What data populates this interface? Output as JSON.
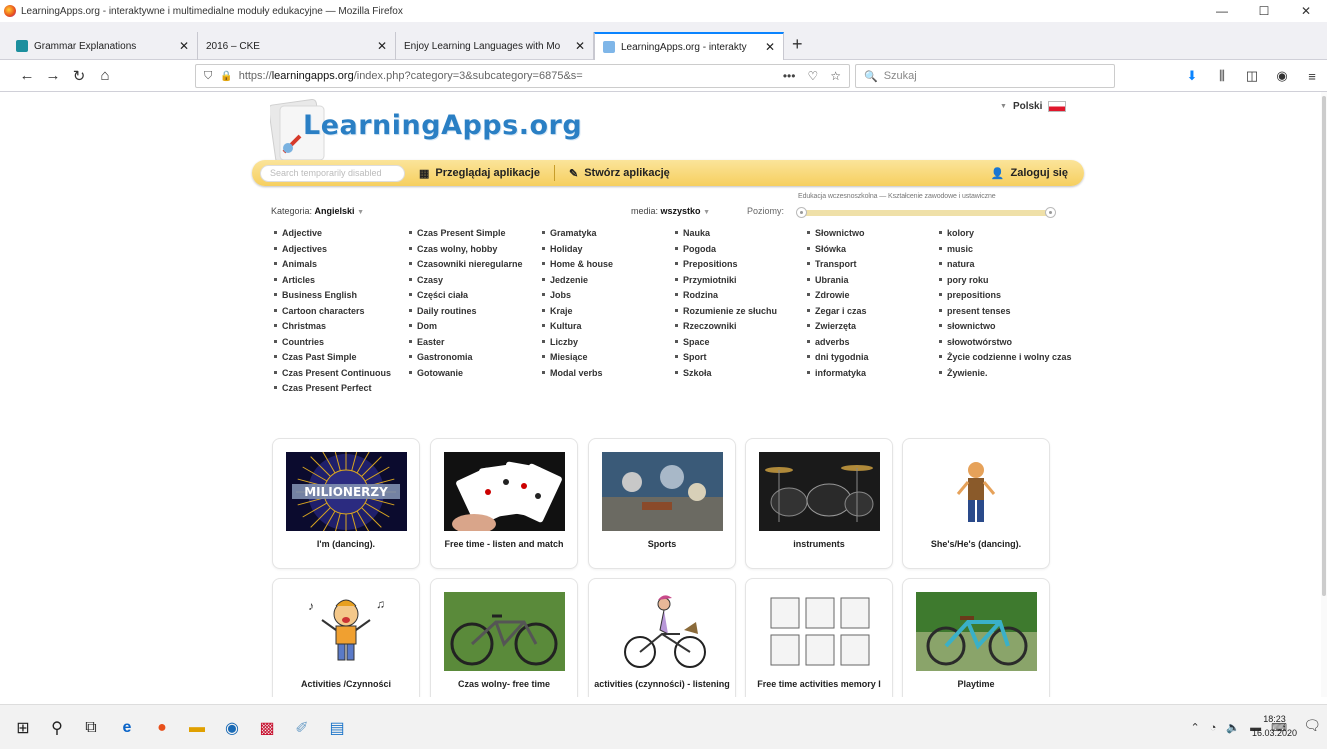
{
  "window": {
    "title": "LearningApps.org - interaktywne i multimedialne moduły edukacyjne — Mozilla Firefox",
    "controls": {
      "minimize": "—",
      "maximize": "☐",
      "close": "✕"
    }
  },
  "tabs": [
    {
      "label": "Grammar Explanations",
      "active": false
    },
    {
      "label": "2016 – CKE",
      "active": false
    },
    {
      "label": "Enjoy Learning Languages with Mo",
      "active": false
    },
    {
      "label": "LearningApps.org - interakty",
      "active": true
    }
  ],
  "newtab_label": "+",
  "nav": {
    "url_prefix": "https://",
    "url_domain": "learningapps.org",
    "url_path": "/index.php?category=3&subcategory=6875&s=",
    "more_icon": "•••",
    "search_placeholder": "Szukaj"
  },
  "site": {
    "logo": "LearningApps.org",
    "language": "Polski",
    "search_placeholder": "Search temporarily disabled",
    "browse_label": "Przeglądaj aplikacje",
    "create_label": "Stwórz aplikację",
    "login_label": "Zaloguj się",
    "levels_caption": "Edukacja wczesnoszkolna — Kształcenie zawodowe i ustawiczne",
    "category_label": "Kategoria:",
    "category_value": "Angielski",
    "media_label": "media:",
    "media_value": "wszystko",
    "levels_label": "Poziomy:",
    "accent": "#f6cf5f"
  },
  "categories": [
    [
      "Adjective",
      "Adjectives",
      "Animals",
      "Articles",
      "Business English",
      "Cartoon characters",
      "Christmas",
      "Countries",
      "Czas Past Simple",
      "Czas Present Continuous",
      "Czas Present Perfect"
    ],
    [
      "Czas Present Simple",
      "Czas wolny, hobby",
      "Czasowniki nieregularne",
      "Czasy",
      "Części ciała",
      "Daily routines",
      "Dom",
      "Easter",
      "Gastronomia",
      "Gotowanie"
    ],
    [
      "Gramatyka",
      "Holiday",
      "Home & house",
      "Jedzenie",
      "Jobs",
      "Kraje",
      "Kultura",
      "Liczby",
      "Miesiące",
      "Modal verbs"
    ],
    [
      "Nauka",
      "Pogoda",
      "Prepositions",
      "Przymiotniki",
      "Rodzina",
      "Rozumienie ze słuchu",
      "Rzeczowniki",
      "Space",
      "Sport",
      "Szkoła"
    ],
    [
      "Słownictwo",
      "Słówka",
      "Transport",
      "Ubrania",
      "Zdrowie",
      "Zegar i czas",
      "Zwierzęta",
      "adverbs",
      "dni tygodnia",
      "informatyka"
    ],
    [
      "kolory",
      "music",
      "natura",
      "pory roku",
      "prepositions",
      "present tenses",
      "słownictwo",
      "słowotwórstwo",
      "Życie codzienne i wolny czas",
      "Żywienie."
    ]
  ],
  "apps": [
    {
      "title": "I'm (dancing).",
      "thumb": "milionerzy",
      "thumb_text": "MILIONERZY"
    },
    {
      "title": "Free time - listen and match",
      "thumb": "cards"
    },
    {
      "title": "Sports",
      "thumb": "sports"
    },
    {
      "title": "instruments",
      "thumb": "drums"
    },
    {
      "title": "She's/He's (dancing).",
      "thumb": "cartoon-person"
    },
    {
      "title": "Activities /Czynności",
      "thumb": "singing-kid"
    },
    {
      "title": "Czas wolny- free time",
      "thumb": "bike"
    },
    {
      "title": "activities (czynności) - listening",
      "thumb": "cyclist"
    },
    {
      "title": "Free time activities memory I",
      "thumb": "memory-grid"
    },
    {
      "title": "Playtime",
      "thumb": "blue-bike"
    }
  ],
  "taskbar": {
    "time": "18:23",
    "date": "16.03.2020"
  }
}
